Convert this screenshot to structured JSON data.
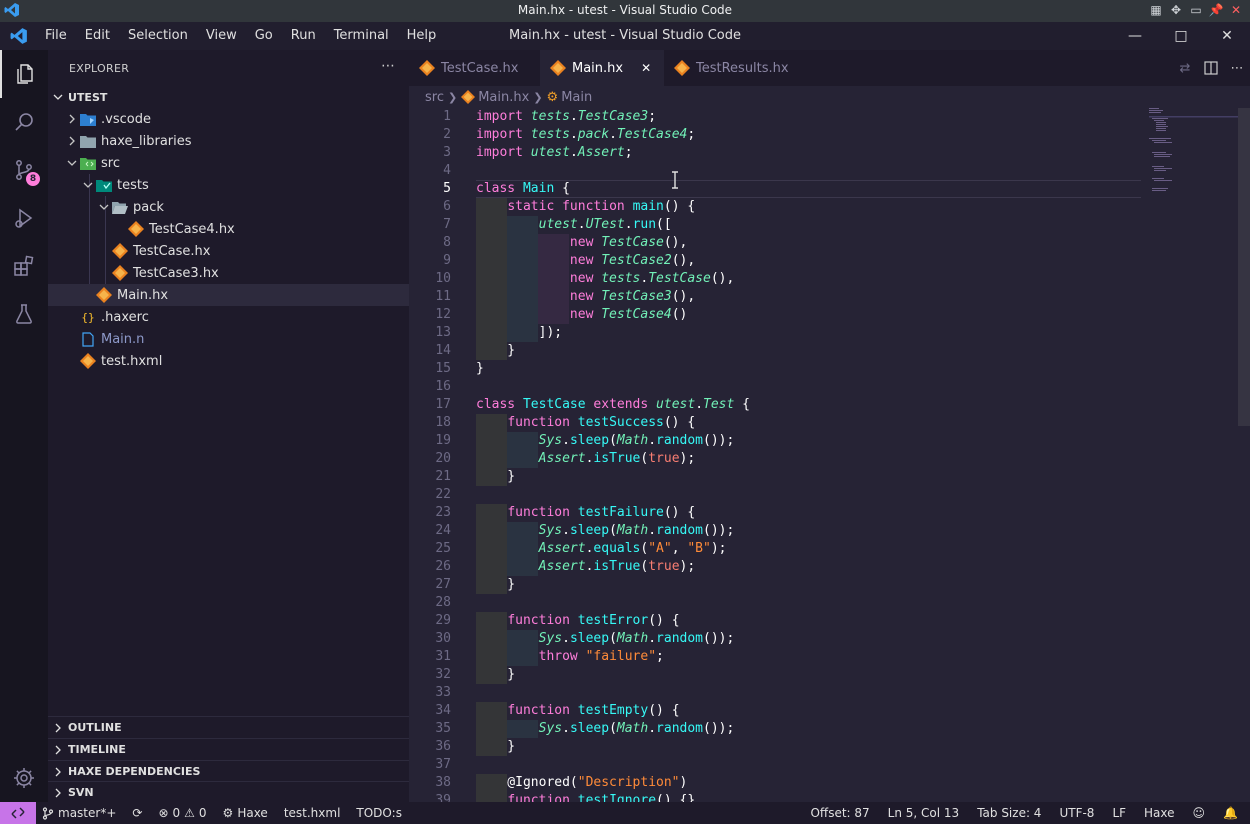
{
  "os": {
    "title": "Main.hx - utest - Visual Studio Code"
  },
  "menubar": {
    "items": [
      "File",
      "Edit",
      "Selection",
      "View",
      "Go",
      "Run",
      "Terminal",
      "Help"
    ],
    "window_title": "Main.hx - utest - Visual Studio Code"
  },
  "activity": {
    "scm_badge": "8"
  },
  "sidebar": {
    "title": "EXPLORER",
    "root": "UTEST",
    "tree": [
      {
        "label": ".vscode"
      },
      {
        "label": "haxe_libraries"
      },
      {
        "label": "src"
      },
      {
        "label": "tests"
      },
      {
        "label": "pack"
      },
      {
        "label": "TestCase4.hx"
      },
      {
        "label": "TestCase.hx"
      },
      {
        "label": "TestCase3.hx"
      },
      {
        "label": "Main.hx"
      },
      {
        "label": ".haxerc"
      },
      {
        "label": "Main.n"
      },
      {
        "label": "test.hxml"
      }
    ],
    "sections": [
      "OUTLINE",
      "TIMELINE",
      "HAXE DEPENDENCIES",
      "SVN"
    ]
  },
  "tabs": [
    {
      "label": "TestCase.hx"
    },
    {
      "label": "Main.hx"
    },
    {
      "label": "TestResults.hx"
    }
  ],
  "breadcrumb": {
    "folder": "src",
    "file": "Main.hx",
    "symbol": "Main"
  },
  "status": {
    "branch": "master*+",
    "errors": "0",
    "warnings": "0",
    "haxe": "Haxe",
    "hxml": "test.hxml",
    "todo": "TODO:s",
    "offset": "Offset: 87",
    "position": "Ln 5, Col 13",
    "tab_size": "Tab Size: 4",
    "encoding": "UTF-8",
    "eol": "LF",
    "language": "Haxe"
  },
  "colors": {
    "accent": "#c774e8",
    "background": "#262335",
    "sidebar": "#1e1a2a",
    "activity": "#171520"
  }
}
